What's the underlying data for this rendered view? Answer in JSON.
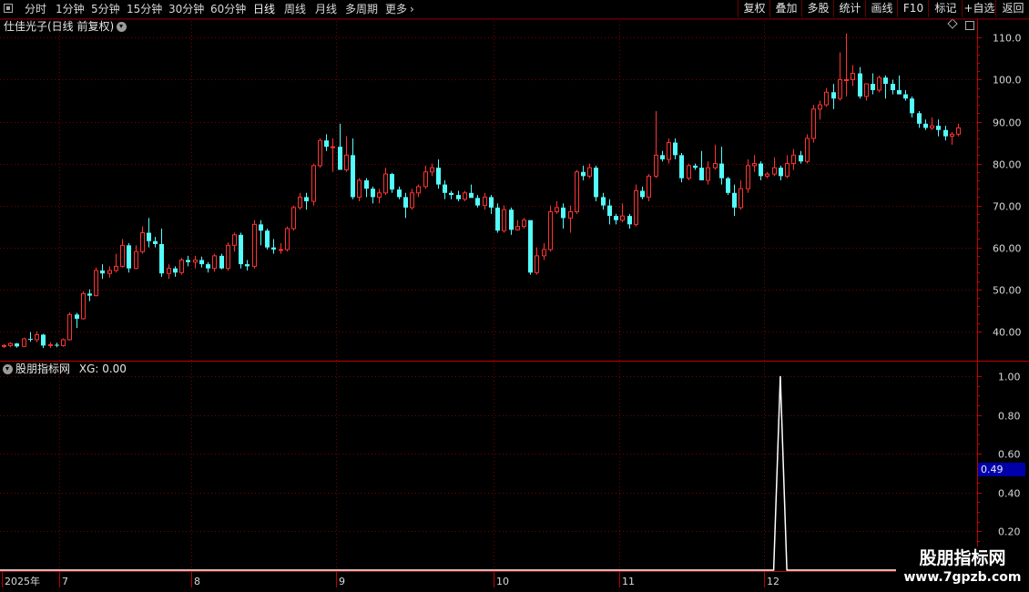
{
  "toolbar": {
    "periods": [
      "分时",
      "1分钟",
      "5分钟",
      "15分钟",
      "30分钟",
      "60分钟",
      "日线",
      "周线",
      "月线",
      "多周期",
      "更多"
    ],
    "active_period": "日线",
    "more_arrow": "chevron-right-icon",
    "right_buttons": [
      "复权",
      "叠加",
      "多股",
      "统计",
      "画线",
      "F10",
      "标记",
      "+自选",
      "返回"
    ]
  },
  "main_panel": {
    "title": "仕佳光子(日线 前复权)",
    "y_ticks": [
      "110.0",
      "100.0",
      "90.00",
      "80.00",
      "70.00",
      "60.00",
      "50.00",
      "40.00"
    ]
  },
  "indicator_panel": {
    "title": "股朋指标网",
    "label": "XG: 0.00",
    "y_ticks": [
      "1.00",
      "0.80",
      "0.60",
      "0.40",
      "0.20"
    ],
    "current_value": "0.49"
  },
  "x_axis": {
    "labels": [
      {
        "text": "2025年",
        "index": 0
      },
      {
        "text": "7",
        "index": 9
      },
      {
        "text": "8",
        "index": 29
      },
      {
        "text": "9",
        "index": 51
      },
      {
        "text": "10",
        "index": 75
      },
      {
        "text": "11",
        "index": 94
      },
      {
        "text": "12",
        "index": 116
      }
    ]
  },
  "watermark": {
    "title": "股朋指标网",
    "url": "www.7gpzb.com"
  },
  "colors": {
    "up": "#ff3232",
    "down": "#54fcfc",
    "grid": "#7a0000",
    "axis": "#c00000",
    "signal": "#ffffff"
  },
  "chart_data": [
    {
      "type": "candlestick",
      "y_unit": "price",
      "ylim": [
        33,
        114
      ],
      "grid": true,
      "candles": [
        [
          36.4,
          37.0,
          36.0,
          36.6
        ],
        [
          36.6,
          37.4,
          36.2,
          37.1
        ],
        [
          37.1,
          37.2,
          36.1,
          36.4
        ],
        [
          36.4,
          38.5,
          36.2,
          38.2
        ],
        [
          38.2,
          39.8,
          37.5,
          38.0
        ],
        [
          38.0,
          40.0,
          37.4,
          39.2
        ],
        [
          39.2,
          39.4,
          36.0,
          36.6
        ],
        [
          36.6,
          37.4,
          36.0,
          36.8
        ],
        [
          36.8,
          37.3,
          36.2,
          36.6
        ],
        [
          36.6,
          38.3,
          36.3,
          38.0
        ],
        [
          38.0,
          44.5,
          37.8,
          44.0
        ],
        [
          44.0,
          44.4,
          40.8,
          43.0
        ],
        [
          43.0,
          49.5,
          42.8,
          49.0
        ],
        [
          49.0,
          50.0,
          47.2,
          48.5
        ],
        [
          48.5,
          55.2,
          48.3,
          54.5
        ],
        [
          54.5,
          56.0,
          52.5,
          53.8
        ],
        [
          53.8,
          55.5,
          52.8,
          54.5
        ],
        [
          54.5,
          58.5,
          54.0,
          55.5
        ],
        [
          55.5,
          62.0,
          55.2,
          60.5
        ],
        [
          60.5,
          61.0,
          54.0,
          55.0
        ],
        [
          55.0,
          60.5,
          54.8,
          59.0
        ],
        [
          59.0,
          65.0,
          58.5,
          63.5
        ],
        [
          63.5,
          67.0,
          60.0,
          61.5
        ],
        [
          61.5,
          62.5,
          60.0,
          60.8
        ],
        [
          60.8,
          64.5,
          53.0,
          53.8
        ],
        [
          53.8,
          56.0,
          52.5,
          55.0
        ],
        [
          55.0,
          55.5,
          53.0,
          54.0
        ],
        [
          54.0,
          57.5,
          53.5,
          57.0
        ],
        [
          57.0,
          58.0,
          55.5,
          56.5
        ],
        [
          56.5,
          58.0,
          55.0,
          57.0
        ],
        [
          57.0,
          57.8,
          55.2,
          56.0
        ],
        [
          56.0,
          56.5,
          54.0,
          55.0
        ],
        [
          55.0,
          58.5,
          54.2,
          58.0
        ],
        [
          58.0,
          58.5,
          54.8,
          55.0
        ],
        [
          55.0,
          61.2,
          54.5,
          60.5
        ],
        [
          60.5,
          63.5,
          59.0,
          63.0
        ],
        [
          63.0,
          63.5,
          55.0,
          56.0
        ],
        [
          56.0,
          57.0,
          54.5,
          55.5
        ],
        [
          55.5,
          66.5,
          55.0,
          65.5
        ],
        [
          65.5,
          66.5,
          60.5,
          64.0
        ],
        [
          64.0,
          64.5,
          59.5,
          60.0
        ],
        [
          60.0,
          62.0,
          58.5,
          59.5
        ],
        [
          59.5,
          61.0,
          58.5,
          59.5
        ],
        [
          59.5,
          65.0,
          59.0,
          64.5
        ],
        [
          64.5,
          70.0,
          64.0,
          69.5
        ],
        [
          69.5,
          73.0,
          69.0,
          72.0
        ],
        [
          72.0,
          73.0,
          69.0,
          71.0
        ],
        [
          71.0,
          80.0,
          70.0,
          79.5
        ],
        [
          79.5,
          86.0,
          79.0,
          85.5
        ],
        [
          85.5,
          87.0,
          83.0,
          84.0
        ],
        [
          84.0,
          86.0,
          78.0,
          84.0
        ],
        [
          84.0,
          89.5,
          80.0,
          78.5
        ],
        [
          78.5,
          86.5,
          78.0,
          82.0
        ],
        [
          82.0,
          86.0,
          71.5,
          72.0
        ],
        [
          72.0,
          76.5,
          71.0,
          76.0
        ],
        [
          76.0,
          76.5,
          72.0,
          74.0
        ],
        [
          74.0,
          74.5,
          70.5,
          72.0
        ],
        [
          72.0,
          74.0,
          70.5,
          73.0
        ],
        [
          73.0,
          79.0,
          72.5,
          77.5
        ],
        [
          77.5,
          77.8,
          73.0,
          73.8
        ],
        [
          73.8,
          74.5,
          71.5,
          72.0
        ],
        [
          72.0,
          73.0,
          67.0,
          69.5
        ],
        [
          69.5,
          74.0,
          69.0,
          73.0
        ],
        [
          73.0,
          75.0,
          72.0,
          74.5
        ],
        [
          74.5,
          79.5,
          74.0,
          78.0
        ],
        [
          78.0,
          80.0,
          77.0,
          79.0
        ],
        [
          79.0,
          81.0,
          74.0,
          75.0
        ],
        [
          75.0,
          76.0,
          71.5,
          73.0
        ],
        [
          73.0,
          73.5,
          71.5,
          72.5
        ],
        [
          72.5,
          73.5,
          71.0,
          71.5
        ],
        [
          71.5,
          73.5,
          71.0,
          73.0
        ],
        [
          73.0,
          75.0,
          72.0,
          71.8
        ],
        [
          71.8,
          72.5,
          69.5,
          70.0
        ],
        [
          70.0,
          73.0,
          69.0,
          72.0
        ],
        [
          72.0,
          72.5,
          68.0,
          69.5
        ],
        [
          69.5,
          70.5,
          63.5,
          64.0
        ],
        [
          64.0,
          70.0,
          63.5,
          69.0
        ],
        [
          69.0,
          69.5,
          63.0,
          64.2
        ],
        [
          64.2,
          66.5,
          64.0,
          65.0
        ],
        [
          65.0,
          67.0,
          64.5,
          66.5
        ],
        [
          66.5,
          56.0,
          53.5,
          54.0
        ],
        [
          54.0,
          60.0,
          53.5,
          58.0
        ],
        [
          58.0,
          61.0,
          57.0,
          59.5
        ],
        [
          59.5,
          70.0,
          59.0,
          68.5
        ],
        [
          68.5,
          71.0,
          68.0,
          69.5
        ],
        [
          69.5,
          70.5,
          64.5,
          67.0
        ],
        [
          67.0,
          70.0,
          63.5,
          68.5
        ],
        [
          68.5,
          78.5,
          68.0,
          78.0
        ],
        [
          78.0,
          79.5,
          76.0,
          77.0
        ],
        [
          77.0,
          80.0,
          76.5,
          79.0
        ],
        [
          79.0,
          79.5,
          71.0,
          72.0
        ],
        [
          72.0,
          73.0,
          69.0,
          70.0
        ],
        [
          70.0,
          71.5,
          65.5,
          67.5
        ],
        [
          67.5,
          68.0,
          65.5,
          66.5
        ],
        [
          66.5,
          70.5,
          66.0,
          67.5
        ],
        [
          67.5,
          68.0,
          64.5,
          65.5
        ],
        [
          65.5,
          75.0,
          65.0,
          73.5
        ],
        [
          73.5,
          74.5,
          71.5,
          72.0
        ],
        [
          72.0,
          77.5,
          71.0,
          77.0
        ],
        [
          77.0,
          92.5,
          76.5,
          82.0
        ],
        [
          82.0,
          83.0,
          80.5,
          81.0
        ],
        [
          81.0,
          86.0,
          80.0,
          85.0
        ],
        [
          85.0,
          86.0,
          81.0,
          82.0
        ],
        [
          82.0,
          82.5,
          75.5,
          76.5
        ],
        [
          76.5,
          80.0,
          76.0,
          79.5
        ],
        [
          79.5,
          80.0,
          78.5,
          79.0
        ],
        [
          79.0,
          83.0,
          77.5,
          76.0
        ],
        [
          76.0,
          80.5,
          75.0,
          79.0
        ],
        [
          79.0,
          84.5,
          78.5,
          80.0
        ],
        [
          80.0,
          84.0,
          75.0,
          76.5
        ],
        [
          76.5,
          76.8,
          72.5,
          73.0
        ],
        [
          73.0,
          75.0,
          67.5,
          69.5
        ],
        [
          69.5,
          76.0,
          69.0,
          74.0
        ],
        [
          74.0,
          81.0,
          73.0,
          79.5
        ],
        [
          79.5,
          82.0,
          78.0,
          80.0
        ],
        [
          80.0,
          80.5,
          76.0,
          77.0
        ],
        [
          77.0,
          78.0,
          76.5,
          77.5
        ],
        [
          77.5,
          81.5,
          77.0,
          79.0
        ],
        [
          79.0,
          79.5,
          76.0,
          77.0
        ],
        [
          77.0,
          82.0,
          76.5,
          80.0
        ],
        [
          80.0,
          83.5,
          78.5,
          82.0
        ],
        [
          82.0,
          83.0,
          80.0,
          80.5
        ],
        [
          80.5,
          87.0,
          80.0,
          86.0
        ],
        [
          86.0,
          94.0,
          85.0,
          93.0
        ],
        [
          93.0,
          95.0,
          90.5,
          94.0
        ],
        [
          94.0,
          98.0,
          93.5,
          97.0
        ],
        [
          97.0,
          99.0,
          93.0,
          95.5
        ],
        [
          95.5,
          106.5,
          95.0,
          100.0
        ],
        [
          100.0,
          111.0,
          96.0,
          100.0
        ],
        [
          100.0,
          103.5,
          98.5,
          101.5
        ],
        [
          101.5,
          103.0,
          95.5,
          96.0
        ],
        [
          96.0,
          96.5,
          95.0,
          99.0
        ],
        [
          99.0,
          101.5,
          96.5,
          97.5
        ],
        [
          97.5,
          101.0,
          97.0,
          100.5
        ],
        [
          100.5,
          101.0,
          95.5,
          99.0
        ],
        [
          99.0,
          100.0,
          96.5,
          97.5
        ],
        [
          97.5,
          101.0,
          97.0,
          96.5
        ],
        [
          96.5,
          97.5,
          95.0,
          95.5
        ],
        [
          95.5,
          96.0,
          91.0,
          92.0
        ],
        [
          92.0,
          92.5,
          88.5,
          89.5
        ],
        [
          89.5,
          90.5,
          88.0,
          88.5
        ],
        [
          88.5,
          91.0,
          88.0,
          89.0
        ],
        [
          89.0,
          90.5,
          86.5,
          88.0
        ],
        [
          88.0,
          89.0,
          85.5,
          86.5
        ],
        [
          86.5,
          87.5,
          84.5,
          87.0
        ],
        [
          87.0,
          89.5,
          86.5,
          88.5
        ]
      ]
    },
    {
      "type": "line",
      "title": "股朋指标网",
      "series": [
        {
          "name": "XG",
          "values": "0 everywhere except 1.0 at index 118"
        }
      ],
      "spike_index": 118,
      "spike_value": 1.0,
      "ylim": [
        0,
        1.07
      ],
      "grid": true
    }
  ]
}
